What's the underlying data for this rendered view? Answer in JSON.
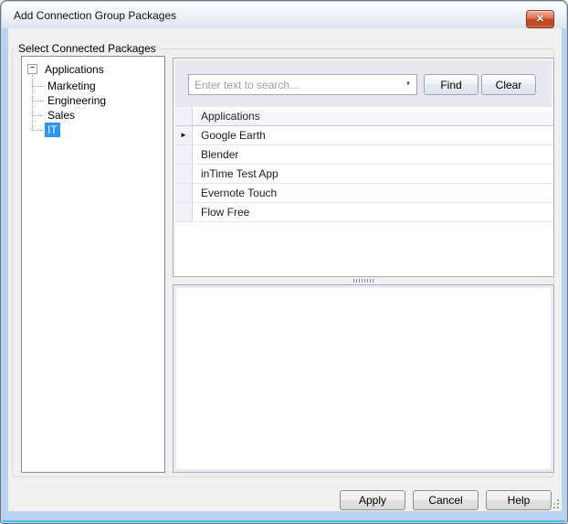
{
  "window": {
    "title": "Add Connection Group Packages"
  },
  "icons": {
    "close": "✕",
    "dropdown": "▼",
    "current_row": "►",
    "expander_collapse": "−"
  },
  "group_box": {
    "label": "Select Connected Packages"
  },
  "tree": {
    "root": "Applications",
    "items": [
      {
        "label": "Marketing",
        "selected": false
      },
      {
        "label": "Engineering",
        "selected": false
      },
      {
        "label": "Sales",
        "selected": false
      },
      {
        "label": "IT",
        "selected": true
      }
    ]
  },
  "search": {
    "value": "",
    "placeholder": "Enter text to search...",
    "find": "Find",
    "clear": "Clear"
  },
  "grid": {
    "column_header": "Applications",
    "rows": [
      {
        "name": "Google Earth",
        "current": true
      },
      {
        "name": "Blender",
        "current": false
      },
      {
        "name": "inTime Test App",
        "current": false
      },
      {
        "name": "Evernote Touch",
        "current": false
      },
      {
        "name": "Flow Free",
        "current": false
      }
    ]
  },
  "footer": {
    "apply": "Apply",
    "cancel": "Cancel",
    "help": "Help"
  },
  "colors": {
    "selection": "#2e96f2",
    "frame": "#b9d3ee",
    "frame_accent": "#3cc6f0",
    "close_button": "#c84a22",
    "client_bg": "#f0f0f0"
  }
}
